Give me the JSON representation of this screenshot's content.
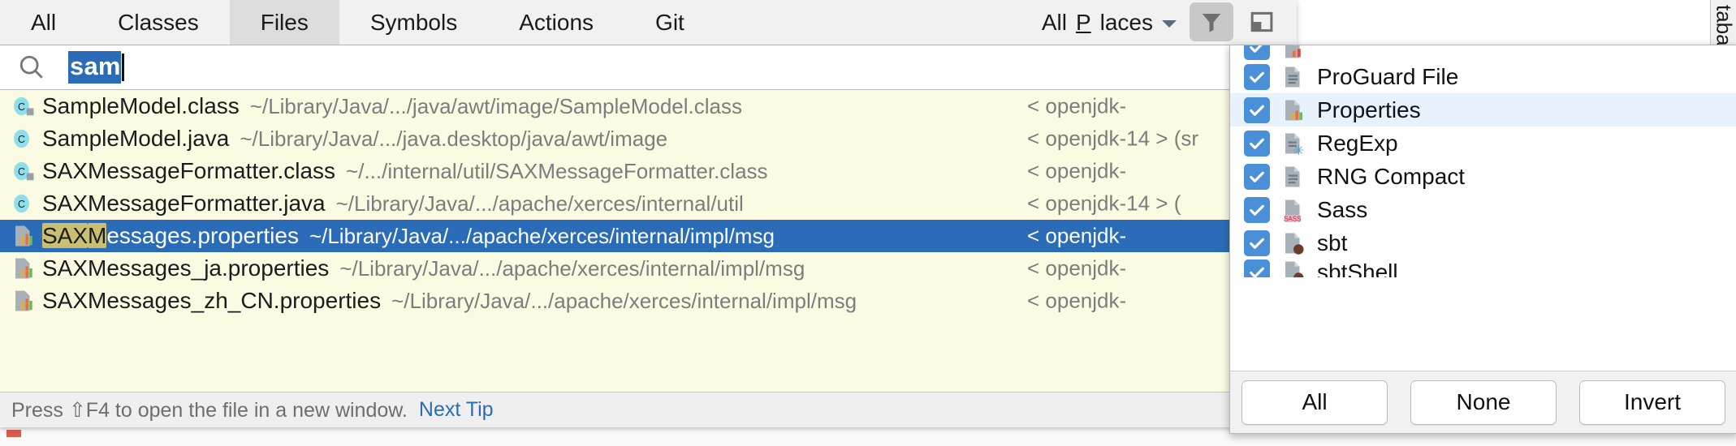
{
  "search_everywhere": {
    "tabs": [
      {
        "label": "All",
        "selected": false
      },
      {
        "label": "Classes",
        "selected": false
      },
      {
        "label": "Files",
        "selected": true
      },
      {
        "label": "Symbols",
        "selected": false
      },
      {
        "label": "Actions",
        "selected": false
      },
      {
        "label": "Git",
        "selected": false
      }
    ],
    "scope": {
      "label_pre": "All ",
      "label_mnemonic": "P",
      "label_post": "laces"
    },
    "toolbar": {
      "filter_icon": "filter-funnel-icon",
      "filter_pressed": true,
      "preview_icon": "preview-panel-icon"
    },
    "search": {
      "icon": "search-icon",
      "value": "sam",
      "selected": true
    },
    "results": [
      {
        "icon": "java-class-file-icon",
        "name": "SampleModel.class",
        "path": "~/Library/Java/.../java/awt/image/SampleModel.class",
        "module": "< openjdk-",
        "match": "",
        "selected": false
      },
      {
        "icon": "java-class-file-icon",
        "name": "SampleModel.java",
        "path": "~/Library/Java/.../java.desktop/java/awt/image",
        "module": "< openjdk-14 > (sr",
        "match": "",
        "selected": false
      },
      {
        "icon": "java-class-file-icon",
        "name": "SAXMessageFormatter.class",
        "path": "~/.../internal/util/SAXMessageFormatter.class",
        "module": "< openjdk-",
        "match": "",
        "selected": false
      },
      {
        "icon": "java-class-file-icon",
        "name": "SAXMessageFormatter.java",
        "path": "~/Library/Java/.../apache/xerces/internal/util",
        "module": "< openjdk-14 > (",
        "match": "",
        "selected": false
      },
      {
        "icon": "properties-file-icon",
        "name": "SAXMessages.properties",
        "name_match": "SAX",
        "name_match2": "M",
        "name_rest": "essages.properties",
        "path": "~/Library/Java/.../apache/xerces/internal/impl/msg",
        "module": "< openjdk-",
        "selected": true
      },
      {
        "icon": "properties-file-icon",
        "name": "SAXMessages_ja.properties",
        "path": "~/Library/Java/.../apache/xerces/internal/impl/msg",
        "module": "< openjdk-",
        "selected": false
      },
      {
        "icon": "properties-file-icon",
        "name": "SAXMessages_zh_CN.properties",
        "path": "~/Library/Java/.../apache/xerces/internal/impl/msg",
        "module": "< openjdk-",
        "selected": false
      }
    ],
    "tip": {
      "text": "Press ⇧F4 to open the file in a new window.",
      "link": "Next Tip"
    }
  },
  "filter_popup": {
    "items": [
      {
        "label": "",
        "icon": "properties-file-icon",
        "checked": true,
        "highlighted": false,
        "clipped": "top"
      },
      {
        "label": "ProGuard File",
        "icon": "proguard-file-icon",
        "checked": true,
        "highlighted": false,
        "clipped": ""
      },
      {
        "label": "Properties",
        "icon": "properties-file-icon",
        "checked": true,
        "highlighted": true,
        "clipped": ""
      },
      {
        "label": "RegExp",
        "icon": "regexp-file-icon",
        "checked": true,
        "highlighted": false,
        "clipped": ""
      },
      {
        "label": "RNG Compact",
        "icon": "rng-compact-file-icon",
        "checked": true,
        "highlighted": false,
        "clipped": ""
      },
      {
        "label": "Sass",
        "icon": "sass-file-icon",
        "checked": true,
        "highlighted": false,
        "clipped": ""
      },
      {
        "label": "sbt",
        "icon": "sbt-file-icon",
        "checked": true,
        "highlighted": false,
        "clipped": ""
      },
      {
        "label": "sbtShell",
        "icon": "sbt-shell-file-icon",
        "checked": true,
        "highlighted": false,
        "clipped": "bottom"
      }
    ],
    "buttons": [
      {
        "label": "All",
        "name": "select-all-button"
      },
      {
        "label": "None",
        "name": "select-none-button"
      },
      {
        "label": "Invert",
        "name": "invert-selection-button"
      }
    ]
  },
  "ide_background": {
    "tool_window_tab": "tabas"
  },
  "colors": {
    "accent_blue": "#2b6cb8",
    "checkbox_blue": "#4a90d9",
    "results_bg": "#fbfbe3",
    "highlight_row": "#e8f2fd",
    "match_highlight": "#c8bf70"
  }
}
